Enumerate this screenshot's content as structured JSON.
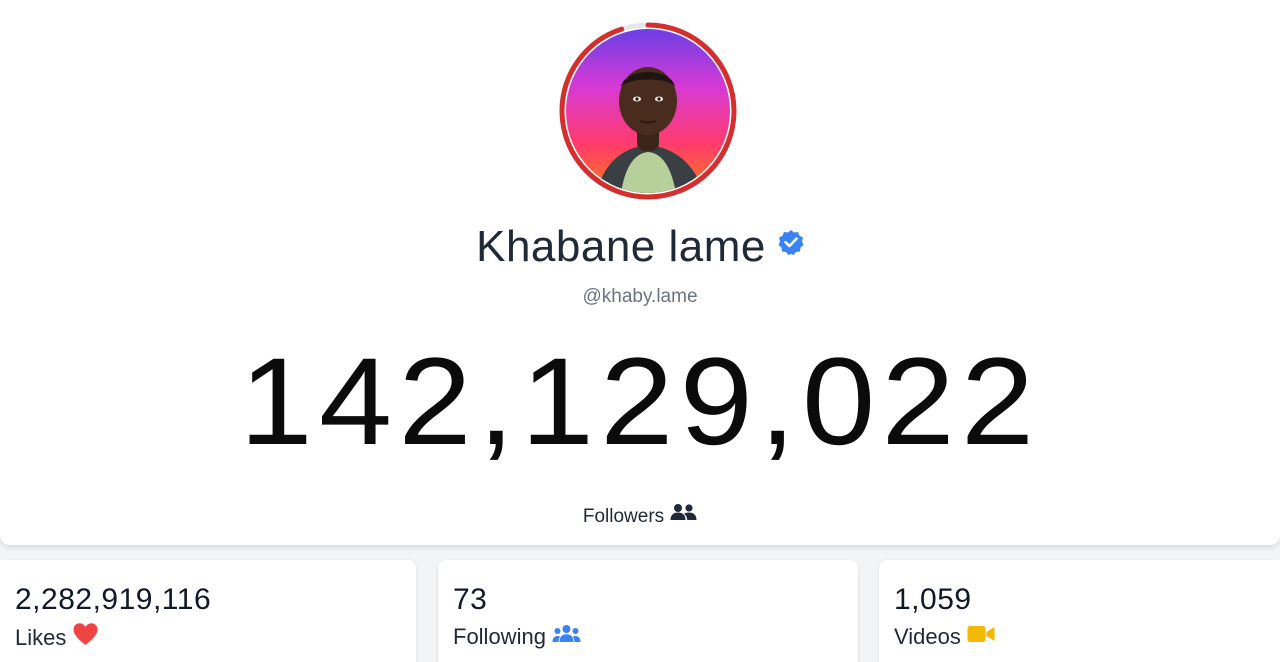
{
  "profile": {
    "display_name": "Khabane lame",
    "handle": "@khaby.lame",
    "verified": true,
    "avatar_icon": "profile-photo",
    "ring_progress": 0.95,
    "ring_color": "#d32f2f"
  },
  "followers": {
    "count": "142,129,022",
    "label": "Followers",
    "icon": "users-icon"
  },
  "stats": [
    {
      "value": "2,282,919,116",
      "label": "Likes",
      "icon": "heart-icon",
      "icon_color": "#ef4444"
    },
    {
      "value": "73",
      "label": "Following",
      "icon": "users-icon",
      "icon_color": "#3b82f6"
    },
    {
      "value": "1,059",
      "label": "Videos",
      "icon": "video-camera-icon",
      "icon_color": "#f5b800"
    }
  ],
  "colors": {
    "verified_badge": "#3b82f6",
    "page_background": "#f3f4f6"
  }
}
